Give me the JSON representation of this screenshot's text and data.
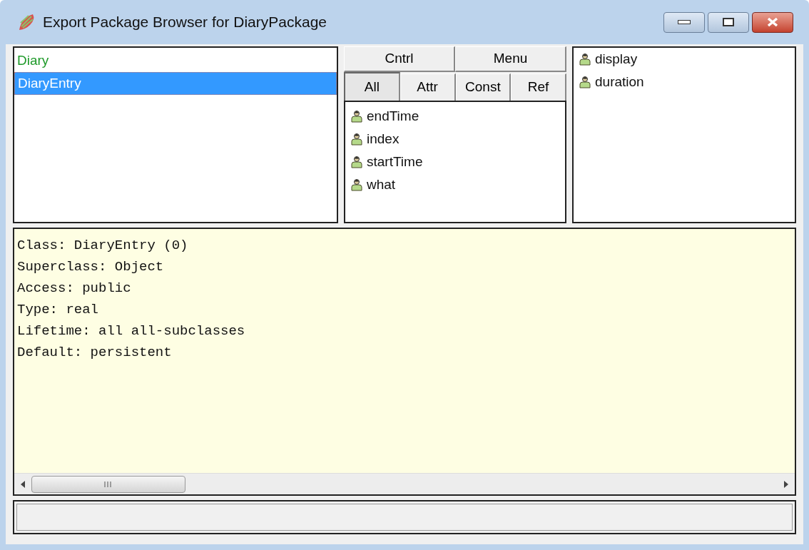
{
  "window": {
    "title": "Export Package Browser for DiaryPackage"
  },
  "classes": [
    {
      "name": "Diary",
      "selected": false,
      "kind": "marked"
    },
    {
      "name": "DiaryEntry",
      "selected": true
    }
  ],
  "buttons": [
    "Cntrl",
    "Menu"
  ],
  "tabs": [
    {
      "label": "All",
      "selected": true
    },
    {
      "label": "Attr",
      "selected": false
    },
    {
      "label": "Const",
      "selected": false
    },
    {
      "label": "Ref",
      "selected": false
    }
  ],
  "members": [
    "endTime",
    "index",
    "startTime",
    "what"
  ],
  "methods": [
    "display",
    "duration"
  ],
  "details": [
    "Class: DiaryEntry (0)",
    "Superclass: Object",
    "Access: public",
    "Type: real",
    "Lifetime: all all-subclasses",
    "Default: persistent"
  ]
}
